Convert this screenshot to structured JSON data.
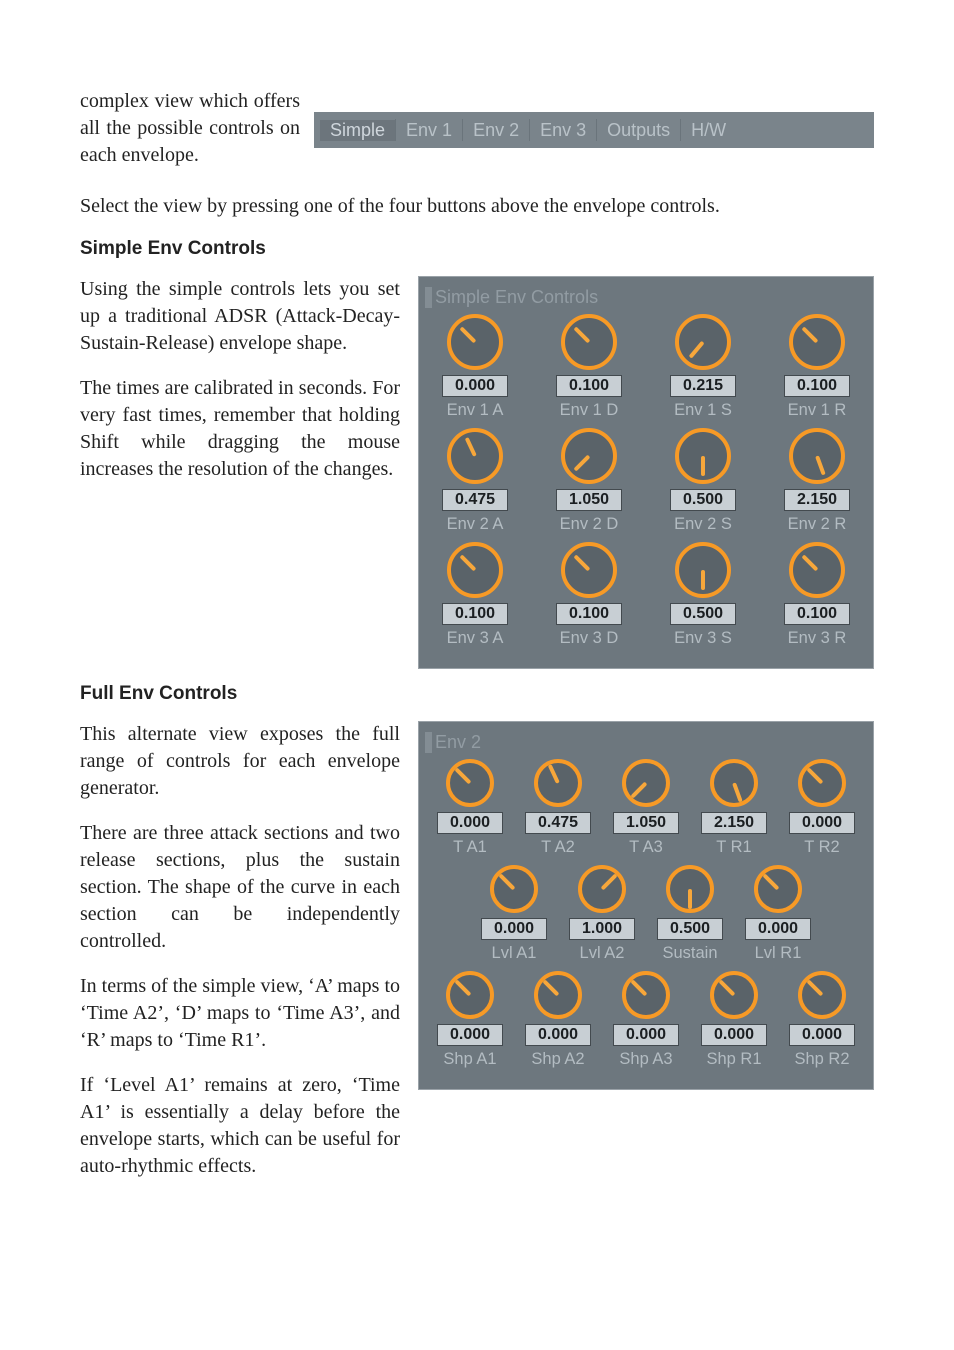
{
  "intro": {
    "side_text": "complex view which offers all the possible controls on each envelope.",
    "after_tabs": "Select the view by pressing one of the four buttons above the envelope controls."
  },
  "tabs": {
    "items": [
      "Simple",
      "Env 1",
      "Env 2",
      "Env 3",
      "Outputs",
      "H/W"
    ],
    "selected": 0
  },
  "simple_section": {
    "heading": "Simple Env Controls",
    "p1": "Using the simple controls lets you set up a traditional ADSR (Attack-Decay-Sustain-Release) envelope shape.",
    "p2": "The times are calibrated in seconds. For very fast times, remember that holding Shift while dragging the mouse increases the resolution of the changes.",
    "panel_title": "Simple Env Controls",
    "rows": [
      [
        {
          "value": "0.000",
          "label": "Env 1 A",
          "angle": 135
        },
        {
          "value": "0.100",
          "label": "Env 1 D",
          "angle": 135
        },
        {
          "value": "0.215",
          "label": "Env 1 S",
          "angle": 40
        },
        {
          "value": "0.100",
          "label": "Env 1 R",
          "angle": 135
        }
      ],
      [
        {
          "value": "0.475",
          "label": "Env 2 A",
          "angle": 155
        },
        {
          "value": "1.050",
          "label": "Env 2 D",
          "angle": 45
        },
        {
          "value": "0.500",
          "label": "Env 2 S",
          "angle": 0
        },
        {
          "value": "2.150",
          "label": "Env 2 R",
          "angle": -20
        }
      ],
      [
        {
          "value": "0.100",
          "label": "Env 3 A",
          "angle": 135
        },
        {
          "value": "0.100",
          "label": "Env 3 D",
          "angle": 135
        },
        {
          "value": "0.500",
          "label": "Env 3 S",
          "angle": 0
        },
        {
          "value": "0.100",
          "label": "Env 3 R",
          "angle": 135
        }
      ]
    ]
  },
  "full_section": {
    "heading": "Full Env Controls",
    "p1": "This alternate view exposes the full range of controls for each envelope generator.",
    "p2": "There are three attack sections and two release sections, plus the sustain section. The shape of the curve in each section can be independently controlled.",
    "p3": "In terms of the simple view, ‘A’ maps to ‘Time A2’, ‘D’ maps to ‘Time A3’, and ‘R’ maps to ‘Time R1’.",
    "p4": "If ‘Level A1’ remains at zero, ‘Time A1’ is essentially a delay before the envelope starts, which can be useful for auto-rhythmic effects.",
    "panel_title": "Env 2",
    "row1": [
      {
        "value": "0.000",
        "label": "T A1",
        "angle": 135
      },
      {
        "value": "0.475",
        "label": "T A2",
        "angle": 155
      },
      {
        "value": "1.050",
        "label": "T A3",
        "angle": 45
      },
      {
        "value": "2.150",
        "label": "T R1",
        "angle": -20
      },
      {
        "value": "0.000",
        "label": "T R2",
        "angle": 135
      }
    ],
    "row2": [
      {
        "value": "0.000",
        "label": "Lvl A1",
        "angle": 135
      },
      {
        "value": "1.000",
        "label": "Lvl A2",
        "angle": -135
      },
      {
        "value": "0.500",
        "label": "Sustain",
        "angle": 0
      },
      {
        "value": "0.000",
        "label": "Lvl R1",
        "angle": 135
      }
    ],
    "row3": [
      {
        "value": "0.000",
        "label": "Shp A1",
        "angle": 135
      },
      {
        "value": "0.000",
        "label": "Shp A2",
        "angle": 135
      },
      {
        "value": "0.000",
        "label": "Shp A3",
        "angle": 135
      },
      {
        "value": "0.000",
        "label": "Shp R1",
        "angle": 135
      },
      {
        "value": "0.000",
        "label": "Shp R2",
        "angle": 135
      }
    ]
  }
}
